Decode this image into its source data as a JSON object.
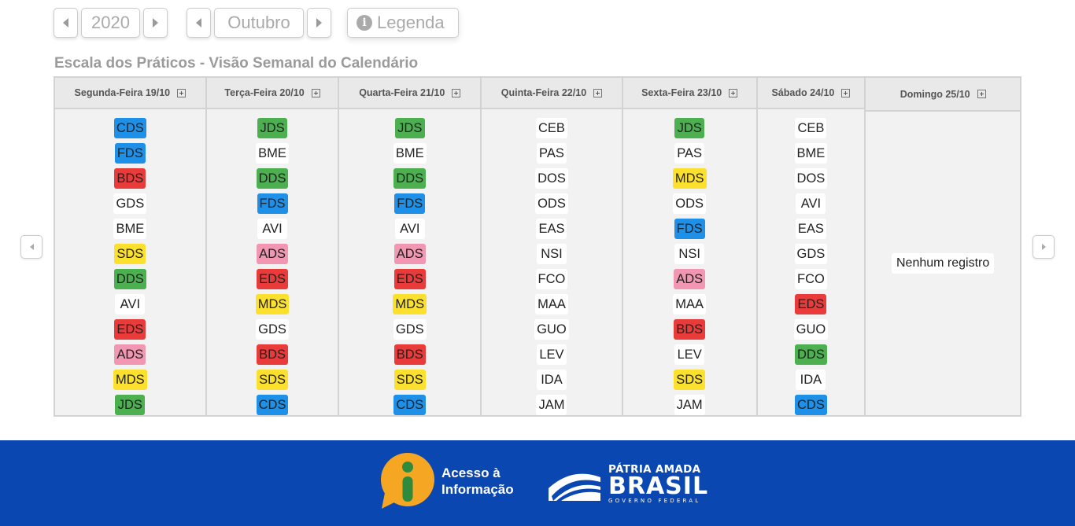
{
  "toolbar": {
    "year": "2020",
    "month": "Outubro",
    "legend_label": "Legenda"
  },
  "page_title": "Escala dos Práticos - Visão Semanal do Calendário",
  "days": [
    {
      "header": "Segunda-Feira 19/10",
      "entries": [
        {
          "code": "CDS",
          "color": "#1e90e8"
        },
        {
          "code": "FDS",
          "color": "#1e90e8"
        },
        {
          "code": "BDS",
          "color": "#ea3b3b"
        },
        {
          "code": "GDS",
          "color": "#ffffff"
        },
        {
          "code": "BME",
          "color": "#ffffff"
        },
        {
          "code": "SDS",
          "color": "#fbe12e"
        },
        {
          "code": "DDS",
          "color": "#4caf50"
        },
        {
          "code": "AVI",
          "color": "#ffffff"
        },
        {
          "code": "EDS",
          "color": "#ea3b3b"
        },
        {
          "code": "ADS",
          "color": "#f197b2"
        },
        {
          "code": "MDS",
          "color": "#fbe12e"
        },
        {
          "code": "JDS",
          "color": "#4caf50"
        }
      ]
    },
    {
      "header": "Terça-Feira 20/10",
      "entries": [
        {
          "code": "JDS",
          "color": "#4caf50"
        },
        {
          "code": "BME",
          "color": "#ffffff"
        },
        {
          "code": "DDS",
          "color": "#4caf50"
        },
        {
          "code": "FDS",
          "color": "#1e90e8"
        },
        {
          "code": "AVI",
          "color": "#ffffff"
        },
        {
          "code": "ADS",
          "color": "#f197b2"
        },
        {
          "code": "EDS",
          "color": "#ea3b3b"
        },
        {
          "code": "MDS",
          "color": "#fbe12e"
        },
        {
          "code": "GDS",
          "color": "#ffffff"
        },
        {
          "code": "BDS",
          "color": "#ea3b3b"
        },
        {
          "code": "SDS",
          "color": "#fbe12e"
        },
        {
          "code": "CDS",
          "color": "#1e90e8"
        }
      ]
    },
    {
      "header": "Quarta-Feira 21/10",
      "entries": [
        {
          "code": "JDS",
          "color": "#4caf50"
        },
        {
          "code": "BME",
          "color": "#ffffff"
        },
        {
          "code": "DDS",
          "color": "#4caf50"
        },
        {
          "code": "FDS",
          "color": "#1e90e8"
        },
        {
          "code": "AVI",
          "color": "#ffffff"
        },
        {
          "code": "ADS",
          "color": "#f197b2"
        },
        {
          "code": "EDS",
          "color": "#ea3b3b"
        },
        {
          "code": "MDS",
          "color": "#fbe12e"
        },
        {
          "code": "GDS",
          "color": "#ffffff"
        },
        {
          "code": "BDS",
          "color": "#ea3b3b"
        },
        {
          "code": "SDS",
          "color": "#fbe12e"
        },
        {
          "code": "CDS",
          "color": "#1e90e8"
        }
      ]
    },
    {
      "header": "Quinta-Feira 22/10",
      "entries": [
        {
          "code": "CEB",
          "color": "#ffffff"
        },
        {
          "code": "PAS",
          "color": "#ffffff"
        },
        {
          "code": "DOS",
          "color": "#ffffff"
        },
        {
          "code": "ODS",
          "color": "#ffffff"
        },
        {
          "code": "EAS",
          "color": "#ffffff"
        },
        {
          "code": "NSI",
          "color": "#ffffff"
        },
        {
          "code": "FCO",
          "color": "#ffffff"
        },
        {
          "code": "MAA",
          "color": "#ffffff"
        },
        {
          "code": "GUO",
          "color": "#ffffff"
        },
        {
          "code": "LEV",
          "color": "#ffffff"
        },
        {
          "code": "IDA",
          "color": "#ffffff"
        },
        {
          "code": "JAM",
          "color": "#ffffff"
        }
      ]
    },
    {
      "header": "Sexta-Feira 23/10",
      "entries": [
        {
          "code": "JDS",
          "color": "#4caf50"
        },
        {
          "code": "PAS",
          "color": "#ffffff"
        },
        {
          "code": "MDS",
          "color": "#fbe12e"
        },
        {
          "code": "ODS",
          "color": "#ffffff"
        },
        {
          "code": "FDS",
          "color": "#1e90e8"
        },
        {
          "code": "NSI",
          "color": "#ffffff"
        },
        {
          "code": "ADS",
          "color": "#f197b2"
        },
        {
          "code": "MAA",
          "color": "#ffffff"
        },
        {
          "code": "BDS",
          "color": "#ea3b3b"
        },
        {
          "code": "LEV",
          "color": "#ffffff"
        },
        {
          "code": "SDS",
          "color": "#fbe12e"
        },
        {
          "code": "JAM",
          "color": "#ffffff"
        }
      ]
    },
    {
      "header": "Sábado 24/10",
      "entries": [
        {
          "code": "CEB",
          "color": "#ffffff"
        },
        {
          "code": "BME",
          "color": "#ffffff"
        },
        {
          "code": "DOS",
          "color": "#ffffff"
        },
        {
          "code": "AVI",
          "color": "#ffffff"
        },
        {
          "code": "EAS",
          "color": "#ffffff"
        },
        {
          "code": "GDS",
          "color": "#ffffff"
        },
        {
          "code": "FCO",
          "color": "#ffffff"
        },
        {
          "code": "EDS",
          "color": "#ea3b3b"
        },
        {
          "code": "GUO",
          "color": "#ffffff"
        },
        {
          "code": "DDS",
          "color": "#4caf50"
        },
        {
          "code": "IDA",
          "color": "#ffffff"
        },
        {
          "code": "CDS",
          "color": "#1e90e8"
        }
      ]
    },
    {
      "header": "Domingo 25/10",
      "entries": [],
      "empty_text": "Nenhum registro"
    }
  ],
  "footer": {
    "acesso_line1": "Acesso à",
    "acesso_line2": "Informação",
    "brasil_top": "PÁTRIA AMADA",
    "brasil_main": "BRASIL",
    "brasil_sub": "GOVERNO FEDERAL"
  }
}
